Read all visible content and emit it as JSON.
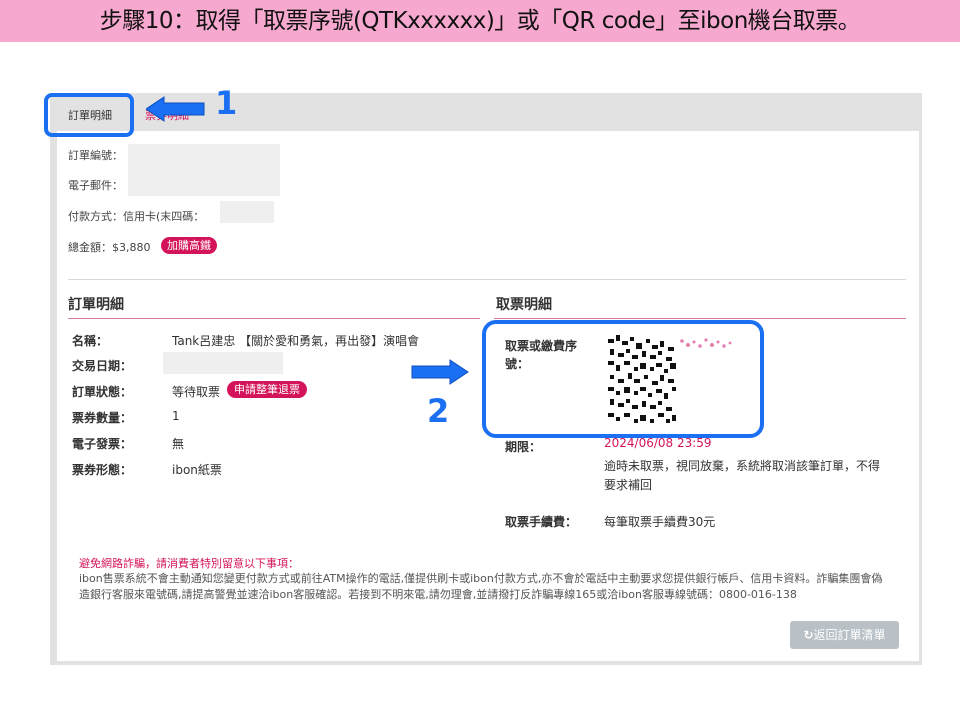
{
  "banner": {
    "text": "步驟10：取得「取票序號(QTKxxxxxx)」或「QR code」至ibon機台取票。"
  },
  "tabs": [
    {
      "label": "訂單明細"
    },
    {
      "label": "票券明細"
    }
  ],
  "callouts": [
    {
      "number": "1"
    },
    {
      "number": "2"
    }
  ],
  "order_summary": {
    "order_no_label": "訂單編號：",
    "email_label": "電子郵件：",
    "payment_label": "付款方式：信用卡(末四碼：",
    "total_label": "總金額：$3,880",
    "addon_badge": "加購高鐵"
  },
  "order_detail": {
    "title": "訂單明細",
    "rows": [
      {
        "label": "名稱：",
        "value": "Tank呂建忠 【關於愛和勇氣，再出發】演唱會"
      },
      {
        "label": "交易日期：",
        "value": ""
      },
      {
        "label": "訂單狀態：",
        "value": "等待取票"
      },
      {
        "label": "票券數量：",
        "value": "1"
      },
      {
        "label": "電子發票：",
        "value": "無"
      },
      {
        "label": "票券形態：",
        "value": "ibon紙票"
      }
    ],
    "refund_button": "申請整筆退票"
  },
  "pickup_detail": {
    "title": "取票明細",
    "serial_label_1": "取票或繳費序",
    "serial_label_2": "號：",
    "deadline_label": "期限：",
    "deadline_value": "2024/06/08 23:59",
    "deadline_note_1": "逾時未取票，視同放棄，系統將取消該筆訂單，不得",
    "deadline_note_2": "要求補回",
    "fee_label": "取票手續費：",
    "fee_value": "每筆取票手續費30元"
  },
  "warning": {
    "title": "避免網路詐騙，請消費者特別留意以下事項：",
    "line1": "ibon售票系統不會主動通知您變更付款方式或前往ATM操作的電話,僅提供刷卡或ibon付款方式,亦不會於電話中主動要求您提供銀行帳戶、信用卡資料。詐騙集團會偽",
    "line2": "造銀行客服來電號碼,請提高警覺並速洽ibon客服確認。若接到不明來電,請勿理會,並請撥打反詐騙專線165或洽ibon客服專線號碼：0800-016-138"
  },
  "footer": {
    "back_button": "返回訂單清單",
    "back_icon": "refresh-icon"
  },
  "colors": {
    "accent": "#1a6ff2",
    "brand": "#d4145a",
    "banner": "#f7a8cf"
  }
}
